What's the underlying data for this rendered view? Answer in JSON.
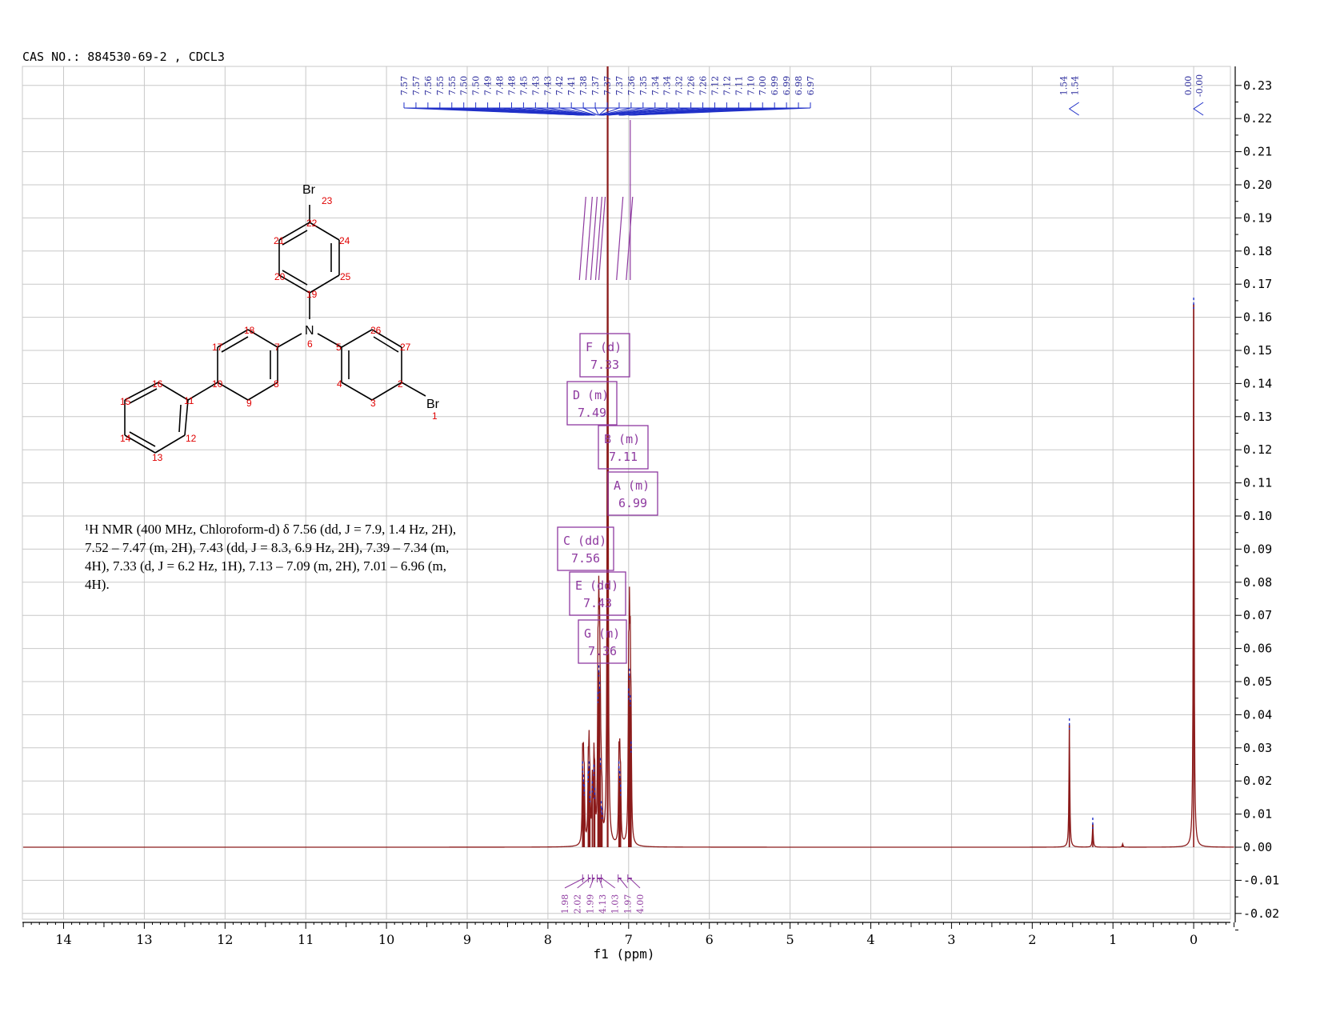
{
  "header": {
    "caption": "CAS NO.: 884530-69-2 , CDCL3"
  },
  "nmr_report": {
    "line1": "¹H NMR (400 MHz, Chloroform-d) δ 7.56 (dd, J = 7.9, 1.4 Hz, 2H),",
    "line2": "7.52 – 7.47 (m, 2H), 7.43 (dd, J = 8.3, 6.9 Hz, 2H), 7.39 – 7.34 (m,",
    "line3": "4H), 7.33 (d, J = 6.2 Hz, 1H), 7.13 – 7.09 (m, 2H), 7.01 – 6.96 (m,",
    "line4": "4H)."
  },
  "molecule": {
    "elements": {
      "br_top": "Br",
      "n": "N",
      "br_right": "Br"
    },
    "atom_numbers": [
      "1",
      "2",
      "3",
      "4",
      "5",
      "6",
      "7",
      "8",
      "9",
      "10",
      "11",
      "12",
      "13",
      "14",
      "15",
      "16",
      "17",
      "18",
      "19",
      "20",
      "21",
      "22",
      "23",
      "24",
      "25",
      "26",
      "27"
    ]
  },
  "colors": {
    "spectrum": "#8b1a1a",
    "peak_marker": "#2030c8",
    "integral": "#8e3aa0",
    "grid": "#c8c8c8",
    "atom_number": "#e00000"
  },
  "chart_data": {
    "type": "line",
    "xlabel": "f1 (ppm)",
    "ylabel": "",
    "xlim": [
      14.5,
      -0.5
    ],
    "x_reversed": true,
    "ylim": [
      -0.02,
      0.23
    ],
    "x_ticks": [
      14,
      13,
      12,
      11,
      10,
      9,
      8,
      7,
      6,
      5,
      4,
      3,
      2,
      1,
      0
    ],
    "y_ticks": [
      0.23,
      0.22,
      0.21,
      0.2,
      0.19,
      0.18,
      0.17,
      0.16,
      0.15,
      0.14,
      0.13,
      0.12,
      0.11,
      0.1,
      0.09,
      0.08,
      0.07,
      0.06,
      0.05,
      0.04,
      0.03,
      0.02,
      0.01,
      0.0,
      -0.01,
      -0.02
    ],
    "y_tick_labels": [
      "0.23",
      "0.22",
      "0.21",
      "0.20",
      "0.19",
      "0.18",
      "0.17",
      "0.16",
      "0.15",
      "0.14",
      "0.13",
      "0.12",
      "0.11",
      "0.10",
      "0.09",
      "0.08",
      "0.07",
      "0.06",
      "0.05",
      "0.04",
      "0.03",
      "0.02",
      "0.01",
      "0.00",
      "-0.01",
      "-0.02"
    ],
    "grid": true,
    "series": [
      {
        "peaks": [
          {
            "x": 7.57,
            "y": 0.024
          },
          {
            "x": 7.56,
            "y": 0.02
          },
          {
            "x": 7.55,
            "y": 0.017
          },
          {
            "x": 7.5,
            "y": 0.021
          },
          {
            "x": 7.49,
            "y": 0.024
          },
          {
            "x": 7.48,
            "y": 0.015
          },
          {
            "x": 7.45,
            "y": 0.018
          },
          {
            "x": 7.43,
            "y": 0.023
          },
          {
            "x": 7.42,
            "y": 0.016
          },
          {
            "x": 7.38,
            "y": 0.045
          },
          {
            "x": 7.37,
            "y": 0.053
          },
          {
            "x": 7.36,
            "y": 0.048
          },
          {
            "x": 7.35,
            "y": 0.025
          },
          {
            "x": 7.34,
            "y": 0.012
          },
          {
            "x": 7.33,
            "y": 0.01
          },
          {
            "x": 7.26,
            "y": 0.26
          },
          {
            "x": 7.12,
            "y": 0.024
          },
          {
            "x": 7.11,
            "y": 0.021
          },
          {
            "x": 7.1,
            "y": 0.017
          },
          {
            "x": 7.0,
            "y": 0.046
          },
          {
            "x": 6.99,
            "y": 0.052
          },
          {
            "x": 6.98,
            "y": 0.044
          },
          {
            "x": 6.97,
            "y": 0.03
          },
          {
            "x": 1.54,
            "y": 0.037
          },
          {
            "x": 1.25,
            "y": 0.007
          },
          {
            "x": 0.88,
            "y": 0.001
          },
          {
            "x": 0.0,
            "y": 0.164
          }
        ]
      }
    ],
    "peak_labels_top": [
      "7.57",
      "7.57",
      "7.56",
      "7.55",
      "7.55",
      "7.50",
      "7.50",
      "7.49",
      "7.48",
      "7.48",
      "7.45",
      "7.43",
      "7.43",
      "7.42",
      "7.41",
      "7.38",
      "7.37",
      "7.37",
      "7.37",
      "7.36",
      "7.35",
      "7.34",
      "7.34",
      "7.32",
      "7.26",
      "7.26",
      "7.12",
      "7.12",
      "7.11",
      "7.10",
      "7.00",
      "6.99",
      "6.99",
      "6.98",
      "6.97"
    ],
    "peak_labels_right": [
      {
        "labels": [
          "1.54",
          "1.54"
        ],
        "x": 1.54
      },
      {
        "labels": [
          "0.00",
          "-0.00"
        ],
        "x": 0.0
      }
    ],
    "multiplets": [
      {
        "id": "F",
        "type": "(d)",
        "shift": "7.33"
      },
      {
        "id": "D",
        "type": "(m)",
        "shift": "7.49"
      },
      {
        "id": "B",
        "type": "(m)",
        "shift": "7.11"
      },
      {
        "id": "A",
        "type": "(m)",
        "shift": "6.99"
      },
      {
        "id": "C",
        "type": "(dd)",
        "shift": "7.56"
      },
      {
        "id": "E",
        "type": "(dd)",
        "shift": "7.43"
      },
      {
        "id": "G",
        "type": "(m)",
        "shift": "7.36"
      }
    ],
    "integrals": [
      "1.98",
      "2.02",
      "1.99",
      "4.13",
      "1.03",
      "1.97",
      "4.00"
    ]
  }
}
